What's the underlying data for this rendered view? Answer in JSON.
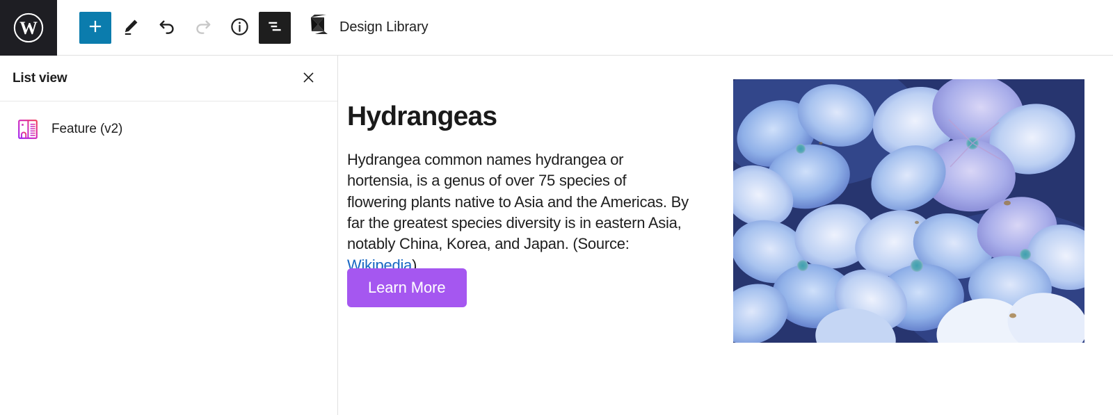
{
  "toolbar": {
    "wp_logo": {
      "name": "wordpress-logo",
      "title": "WordPress"
    },
    "buttons": [
      {
        "id": "add-block",
        "icon": "plus-icon",
        "label": "Add block",
        "state": "primary"
      },
      {
        "id": "edit-tool",
        "icon": "pencil-icon",
        "label": "Tools",
        "state": "default"
      },
      {
        "id": "undo",
        "icon": "undo-icon",
        "label": "Undo",
        "state": "default"
      },
      {
        "id": "redo",
        "icon": "redo-icon",
        "label": "Redo",
        "state": "disabled"
      },
      {
        "id": "details",
        "icon": "info-icon",
        "label": "Details",
        "state": "default"
      },
      {
        "id": "list-view",
        "icon": "list-view-icon",
        "label": "List View",
        "state": "pressed"
      }
    ],
    "design_library": {
      "icon": "design-library-logo",
      "label": "Design Library"
    }
  },
  "sidebar": {
    "title": "List view",
    "close_icon": "close-icon",
    "close_label": "Close",
    "blocks": [
      {
        "icon": "feature-block-icon",
        "label": "Feature (v2)"
      }
    ]
  },
  "canvas": {
    "heading": "Hydrangeas",
    "paragraph_before_link": "Hydrangea common names hydrangea or hortensia, is a genus of over 75 species of flowering plants native to Asia and the Americas. By far the greatest species diversity is in eastern Asia, notably China, Korea, and Japan. (Source: ",
    "link_text": "Wikipedia",
    "paragraph_after_link": ")",
    "button_label": "Learn More",
    "image_alt": "Close-up of blue hydrangea flowers"
  },
  "colors": {
    "wp_logo_bg": "#1e1e23",
    "primary_blue": "#0b7cad",
    "list_view_active": "#1e1e1e",
    "button_purple": "#a557f0",
    "link_blue": "#1766c2",
    "text_dark": "#1e1e1e",
    "border_gray": "#e0e0e0",
    "block_icon_gradient_start": "#a020f0",
    "block_icon_gradient_end": "#f0405a"
  }
}
